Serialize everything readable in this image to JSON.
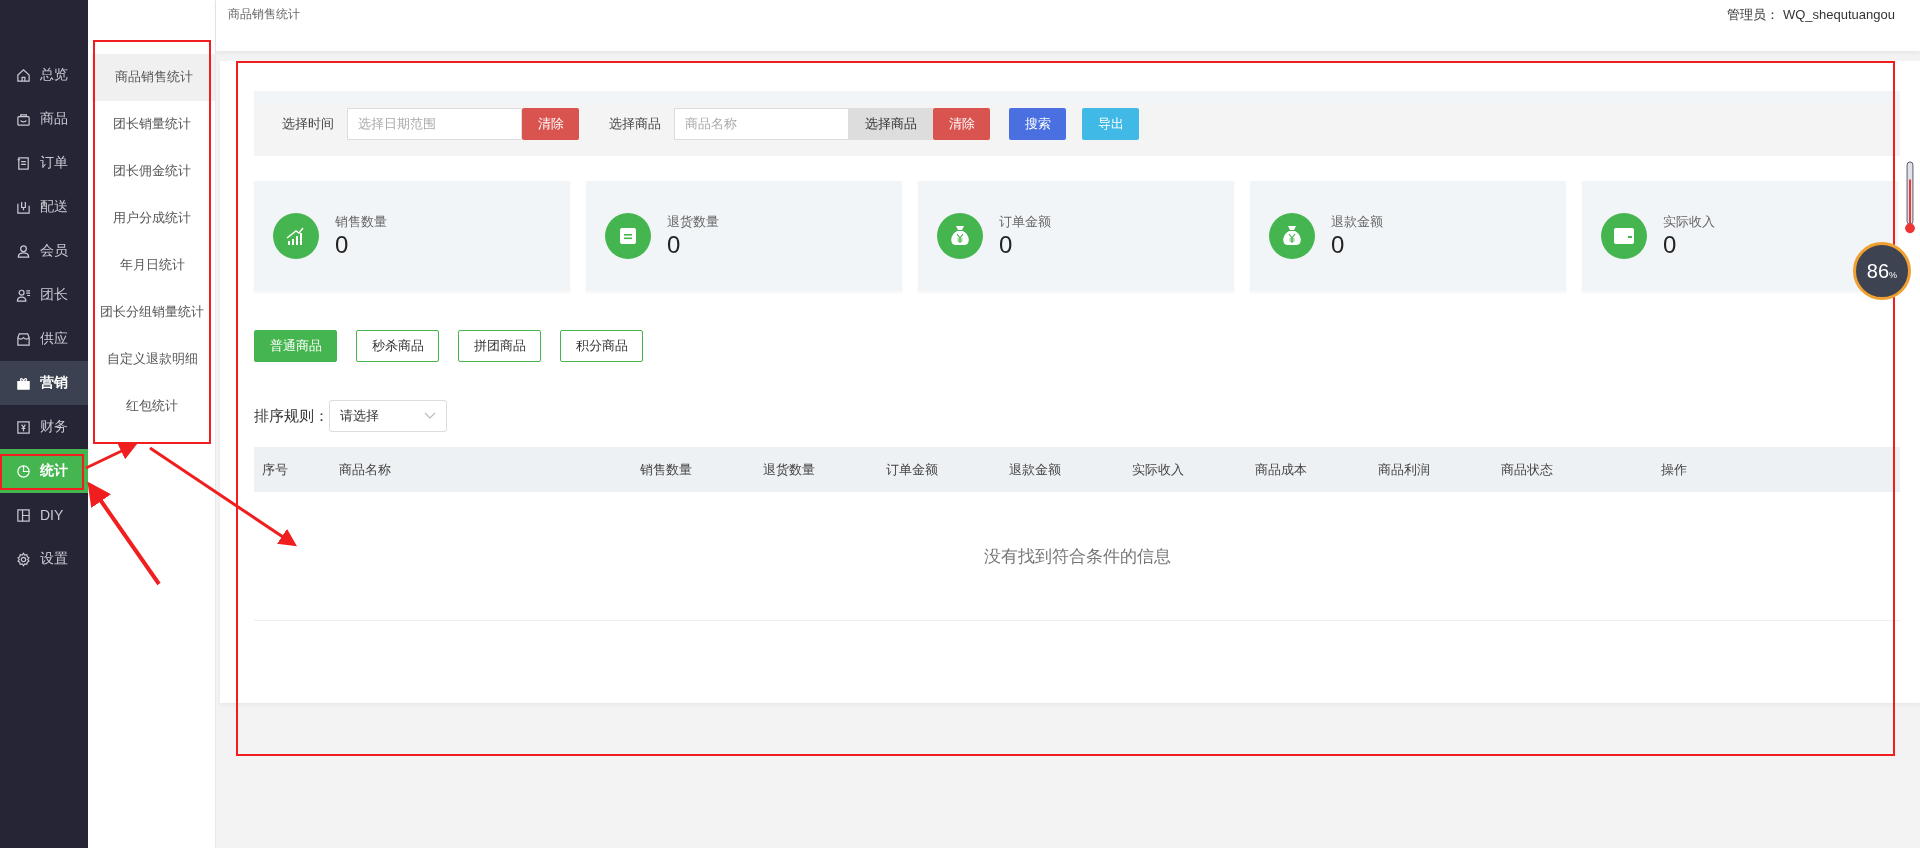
{
  "header": {
    "breadcrumb": "商品销售统计",
    "admin": "管理员： WQ_shequtuangou"
  },
  "main_nav": [
    {
      "label": "总览",
      "selected": false,
      "hovered": false
    },
    {
      "label": "商品",
      "selected": false,
      "hovered": false
    },
    {
      "label": "订单",
      "selected": false,
      "hovered": false
    },
    {
      "label": "配送",
      "selected": false,
      "hovered": false
    },
    {
      "label": "会员",
      "selected": false,
      "hovered": false
    },
    {
      "label": "团长",
      "selected": false,
      "hovered": false
    },
    {
      "label": "供应",
      "selected": false,
      "hovered": false
    },
    {
      "label": "营销",
      "selected": false,
      "hovered": true
    },
    {
      "label": "财务",
      "selected": false,
      "hovered": false
    },
    {
      "label": "统计",
      "selected": true,
      "hovered": false
    },
    {
      "label": "DIY",
      "selected": false,
      "hovered": false
    },
    {
      "label": "设置",
      "selected": false,
      "hovered": false
    }
  ],
  "sub_nav": [
    {
      "label": "商品销售统计",
      "selected": true
    },
    {
      "label": "团长销量统计",
      "selected": false
    },
    {
      "label": "团长佣金统计",
      "selected": false
    },
    {
      "label": "用户分成统计",
      "selected": false
    },
    {
      "label": "年月日统计",
      "selected": false
    },
    {
      "label": "团长分组销量统计",
      "selected": false
    },
    {
      "label": "自定义退款明细",
      "selected": false
    },
    {
      "label": "红包统计",
      "selected": false
    }
  ],
  "filters": {
    "time_label": "选择时间",
    "date_placeholder": "选择日期范围",
    "clear_date": "清除",
    "goods_label": "选择商品",
    "goods_placeholder": "商品名称",
    "select_goods": "选择商品",
    "clear_goods": "清除",
    "search": "搜索",
    "export": "导出"
  },
  "stats": [
    {
      "label": "销售数量",
      "value": "0"
    },
    {
      "label": "退货数量",
      "value": "0"
    },
    {
      "label": "订单金额",
      "value": "0"
    },
    {
      "label": "退款金额",
      "value": "0"
    },
    {
      "label": "实际收入",
      "value": "0"
    }
  ],
  "goods_tabs": [
    {
      "label": "普通商品",
      "selected": true
    },
    {
      "label": "秒杀商品",
      "selected": false
    },
    {
      "label": "拼团商品",
      "selected": false
    },
    {
      "label": "积分商品",
      "selected": false
    }
  ],
  "sort": {
    "label": "排序规则：",
    "value": "请选择"
  },
  "table": {
    "columns": [
      "序号",
      "商品名称",
      "销售数量",
      "退货数量",
      "订单金额",
      "退款金额",
      "实际收入",
      "商品成本",
      "商品利润",
      "商品状态",
      "操作"
    ],
    "empty_message": "没有找到符合条件的信息"
  },
  "memory_widget": {
    "value": "86",
    "unit": "%"
  }
}
